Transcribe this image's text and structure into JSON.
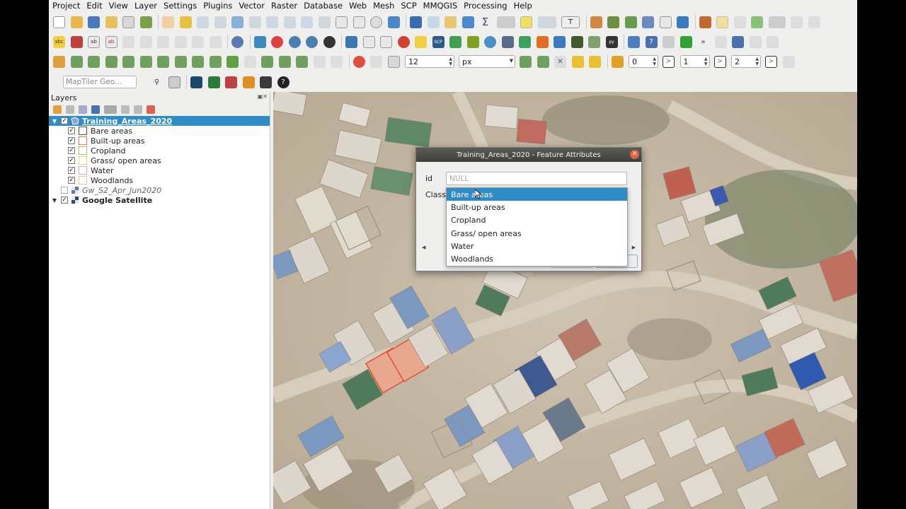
{
  "menubar": [
    "Project",
    "Edit",
    "View",
    "Layer",
    "Settings",
    "Plugins",
    "Vector",
    "Raster",
    "Database",
    "Web",
    "Mesh",
    "SCP",
    "MMQGIS",
    "Processing",
    "Help"
  ],
  "toolbar3": {
    "snap_tolerance": "12",
    "units": "px",
    "spin1": "0",
    "spin2": "1",
    "spin3": "2"
  },
  "search": {
    "placeholder": "MapTiler Geo..."
  },
  "layers_panel": {
    "title": "Layers",
    "layers": [
      {
        "name": "Training_Areas_2020",
        "checked": true,
        "expanded": true,
        "selected": true,
        "icon": "polygon-layer-icon"
      },
      {
        "name": "Bare areas",
        "checked": true,
        "color": "#5a4a3a",
        "fill": "#ffffff"
      },
      {
        "name": "Built-up areas",
        "checked": true,
        "color": "#e07a50",
        "fill": "#ffffff"
      },
      {
        "name": "Cropland",
        "checked": true,
        "color": "#c8b470",
        "fill": "#ffffff"
      },
      {
        "name": "Grass/ open areas",
        "checked": true,
        "color": "#d8e070",
        "fill": "#ffffff"
      },
      {
        "name": "Water",
        "checked": true,
        "color": "#e0a0d0",
        "fill": "#ffffff"
      },
      {
        "name": "Woodlands",
        "checked": true,
        "color": "#e8c898",
        "fill": "#ffffff"
      },
      {
        "name": "Gw_S2_Apr_Jun2020",
        "checked": false,
        "icon": "raster-layer-icon"
      },
      {
        "name": "Google Satellite",
        "checked": true,
        "expanded": true,
        "icon": "raster-layer-icon"
      }
    ]
  },
  "dialog": {
    "title": "Training_Areas_2020 - Feature Attributes",
    "id_label": "id",
    "id_value": "NULL",
    "class_label": "Class",
    "class_options": [
      "Bare areas",
      "Built-up areas",
      "Cropland",
      "Grass/ open areas",
      "Water",
      "Woodlands"
    ],
    "highlighted_option": "Bare areas"
  },
  "colors": {
    "selection": "#308cc6",
    "dialog_title_bg": "#4a4a47",
    "close_button": "#e2603a"
  }
}
